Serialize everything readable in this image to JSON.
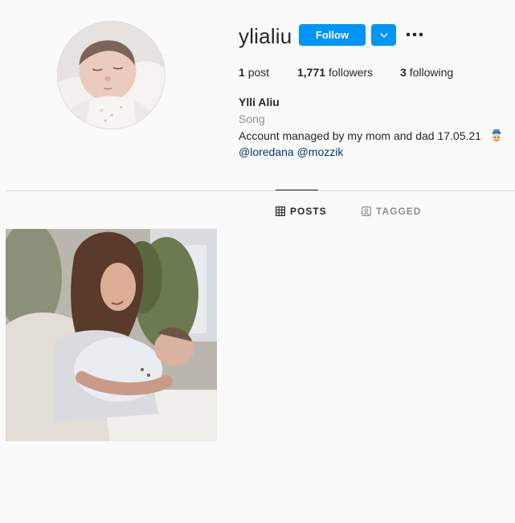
{
  "profile": {
    "username": "ylialiu",
    "follow_label": "Follow",
    "stats": {
      "posts_count": "1",
      "posts_label": "post",
      "followers_count": "1,771",
      "followers_label": "followers",
      "following_count": "3",
      "following_label": "following"
    },
    "full_name": "Ylli Aliu",
    "category": "Song",
    "bio": "Account managed by my mom and dad 17.05.21",
    "mentions": [
      "@loredana",
      "@mozzik"
    ]
  },
  "tabs": [
    {
      "label": "POSTS",
      "icon": "grid-icon",
      "active": true
    },
    {
      "label": "TAGGED",
      "icon": "tagged-icon",
      "active": false
    }
  ],
  "colors": {
    "accent": "#0095f6",
    "link": "#00376b",
    "muted": "#8e8e8e",
    "text": "#262626",
    "background": "#fafafa"
  }
}
